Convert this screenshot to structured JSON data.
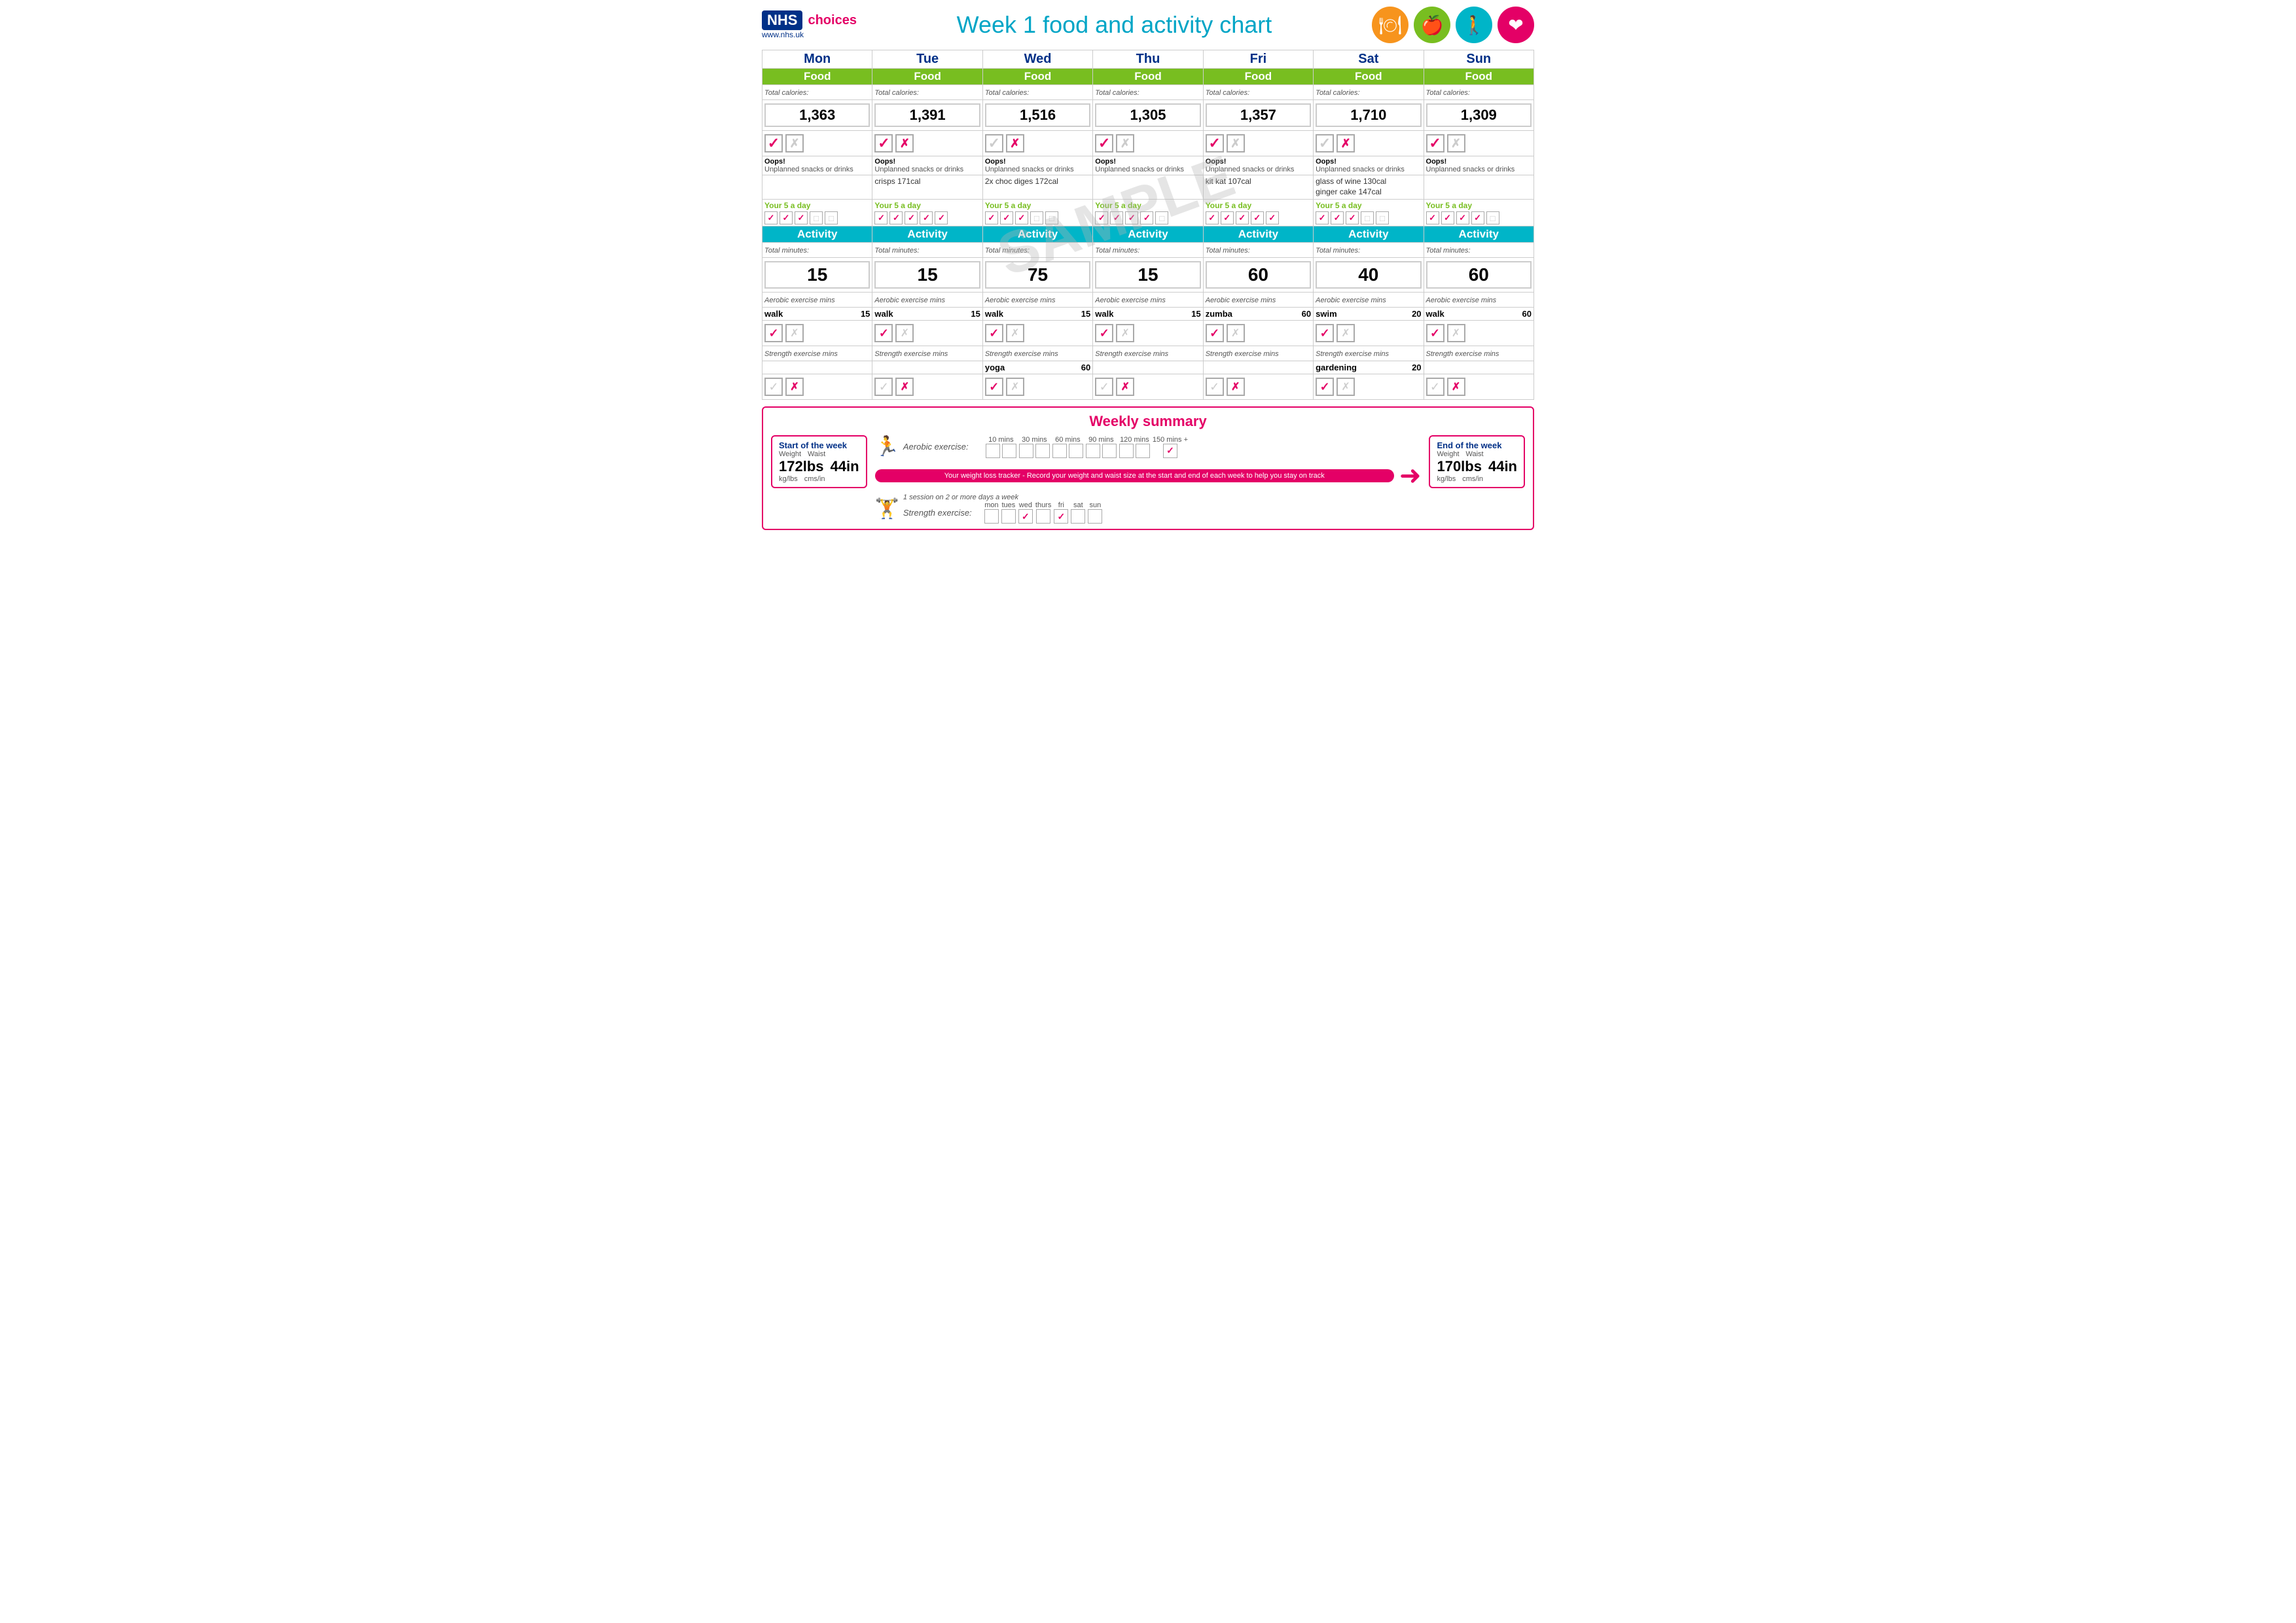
{
  "header": {
    "nhs": "NHS",
    "choices": "choices",
    "url": "www.nhs.uk",
    "title": "Week 1 food and activity chart",
    "icons": [
      {
        "name": "food-icon",
        "bg": "#f7941d",
        "symbol": "🍽"
      },
      {
        "name": "apple-icon",
        "bg": "#78be20",
        "symbol": "🍎"
      },
      {
        "name": "runner-icon",
        "bg": "#00b5c8",
        "symbol": "🚶"
      },
      {
        "name": "heart-icon",
        "bg": "#e40066",
        "symbol": "❤"
      }
    ]
  },
  "days": [
    "Mon",
    "Tue",
    "Wed",
    "Thu",
    "Fri",
    "Sat",
    "Sun"
  ],
  "food_label": "Food",
  "activity_label": "Activity",
  "total_calories_label": "Total calories:",
  "total_minutes_label": "Total minutes:",
  "oops_label": "Oops!",
  "unplanned_label": "Unplanned snacks or drinks",
  "your5aday_label": "Your 5 a day",
  "aerobic_label": "Aerobic exercise",
  "strength_label": "Strength exercise",
  "mins_label": "mins",
  "columns": [
    {
      "day": "Mon",
      "calories": "1,363",
      "tick1": true,
      "cross1": false,
      "snacks": "",
      "five_checks": [
        true,
        true,
        true,
        false,
        false
      ],
      "activity_minutes": "15",
      "aerobic_exercise": "walk",
      "aerobic_mins": "15",
      "aerobic_tick": true,
      "aerobic_cross": false,
      "strength_exercise": "",
      "strength_mins": "",
      "strength_tick": false,
      "strength_cross": true
    },
    {
      "day": "Tue",
      "calories": "1,391",
      "tick1": true,
      "cross1": true,
      "snacks": "crisps 171cal",
      "five_checks": [
        true,
        true,
        true,
        true,
        true
      ],
      "activity_minutes": "15",
      "aerobic_exercise": "walk",
      "aerobic_mins": "15",
      "aerobic_tick": true,
      "aerobic_cross": false,
      "strength_exercise": "",
      "strength_mins": "",
      "strength_tick": false,
      "strength_cross": true
    },
    {
      "day": "Wed",
      "calories": "1,516",
      "tick1": false,
      "cross1": true,
      "snacks": "2x choc diges 172cal",
      "five_checks": [
        true,
        true,
        true,
        false,
        false
      ],
      "activity_minutes": "75",
      "aerobic_exercise": "walk",
      "aerobic_mins": "15",
      "aerobic_tick": true,
      "aerobic_cross": false,
      "strength_exercise": "yoga",
      "strength_mins": "60",
      "strength_tick": true,
      "strength_cross": false
    },
    {
      "day": "Thu",
      "calories": "1,305",
      "tick1": true,
      "cross1": false,
      "snacks": "",
      "five_checks": [
        true,
        true,
        true,
        true,
        false
      ],
      "activity_minutes": "15",
      "aerobic_exercise": "walk",
      "aerobic_mins": "15",
      "aerobic_tick": true,
      "aerobic_cross": false,
      "strength_exercise": "",
      "strength_mins": "",
      "strength_tick": false,
      "strength_cross": true
    },
    {
      "day": "Fri",
      "calories": "1,357",
      "tick1": true,
      "cross1": false,
      "snacks": "kit kat 107cal",
      "five_checks": [
        true,
        true,
        true,
        true,
        true
      ],
      "activity_minutes": "60",
      "aerobic_exercise": "zumba",
      "aerobic_mins": "60",
      "aerobic_tick": true,
      "aerobic_cross": false,
      "strength_exercise": "",
      "strength_mins": "",
      "strength_tick": false,
      "strength_cross": true
    },
    {
      "day": "Sat",
      "calories": "1,710",
      "tick1": false,
      "cross1": true,
      "snacks": "glass of wine 130cal\nginger cake  147cal",
      "five_checks": [
        true,
        true,
        true,
        false,
        false
      ],
      "activity_minutes": "40",
      "aerobic_exercise": "swim",
      "aerobic_mins": "20",
      "aerobic_tick": true,
      "aerobic_cross": false,
      "strength_exercise": "gardening",
      "strength_mins": "20",
      "strength_tick": true,
      "strength_cross": false
    },
    {
      "day": "Sun",
      "calories": "1,309",
      "tick1": true,
      "cross1": false,
      "snacks": "",
      "five_checks": [
        true,
        true,
        true,
        true,
        false
      ],
      "activity_minutes": "60",
      "aerobic_exercise": "walk",
      "aerobic_mins": "60",
      "aerobic_tick": true,
      "aerobic_cross": false,
      "strength_exercise": "",
      "strength_mins": "",
      "strength_tick": false,
      "strength_cross": true
    }
  ],
  "weekly_summary": {
    "title": "Weekly summary",
    "aerobic_label": "Aerobic exercise:",
    "strength_label": "Strength exercise:",
    "aerobic_mins_labels": [
      "10 mins",
      "30 mins",
      "60 mins",
      "90 mins",
      "120 mins",
      "150 mins +"
    ],
    "aerobic_checked_index": 5,
    "strength_days": [
      "mon",
      "tues",
      "wed",
      "thurs",
      "fri",
      "sat",
      "sun"
    ],
    "strength_checked": [
      false,
      false,
      true,
      false,
      true,
      false,
      false
    ],
    "tracker_text": "Your weight loss tracker - Record your weight and waist size at the start and end of each week to help you stay on track",
    "strength_note": "1 session on 2 or more days a week",
    "start": {
      "title": "Start of the week",
      "weight_label": "Weight",
      "waist_label": "Waist",
      "weight": "172lbs",
      "waist": "44in",
      "weight_unit": "kg/lbs",
      "waist_unit": "cms/in"
    },
    "end": {
      "title": "End of the week",
      "weight_label": "Weight",
      "waist_label": "Waist",
      "weight": "170lbs",
      "waist": "44in",
      "weight_unit": "kg/lbs",
      "waist_unit": "cms/in"
    }
  }
}
